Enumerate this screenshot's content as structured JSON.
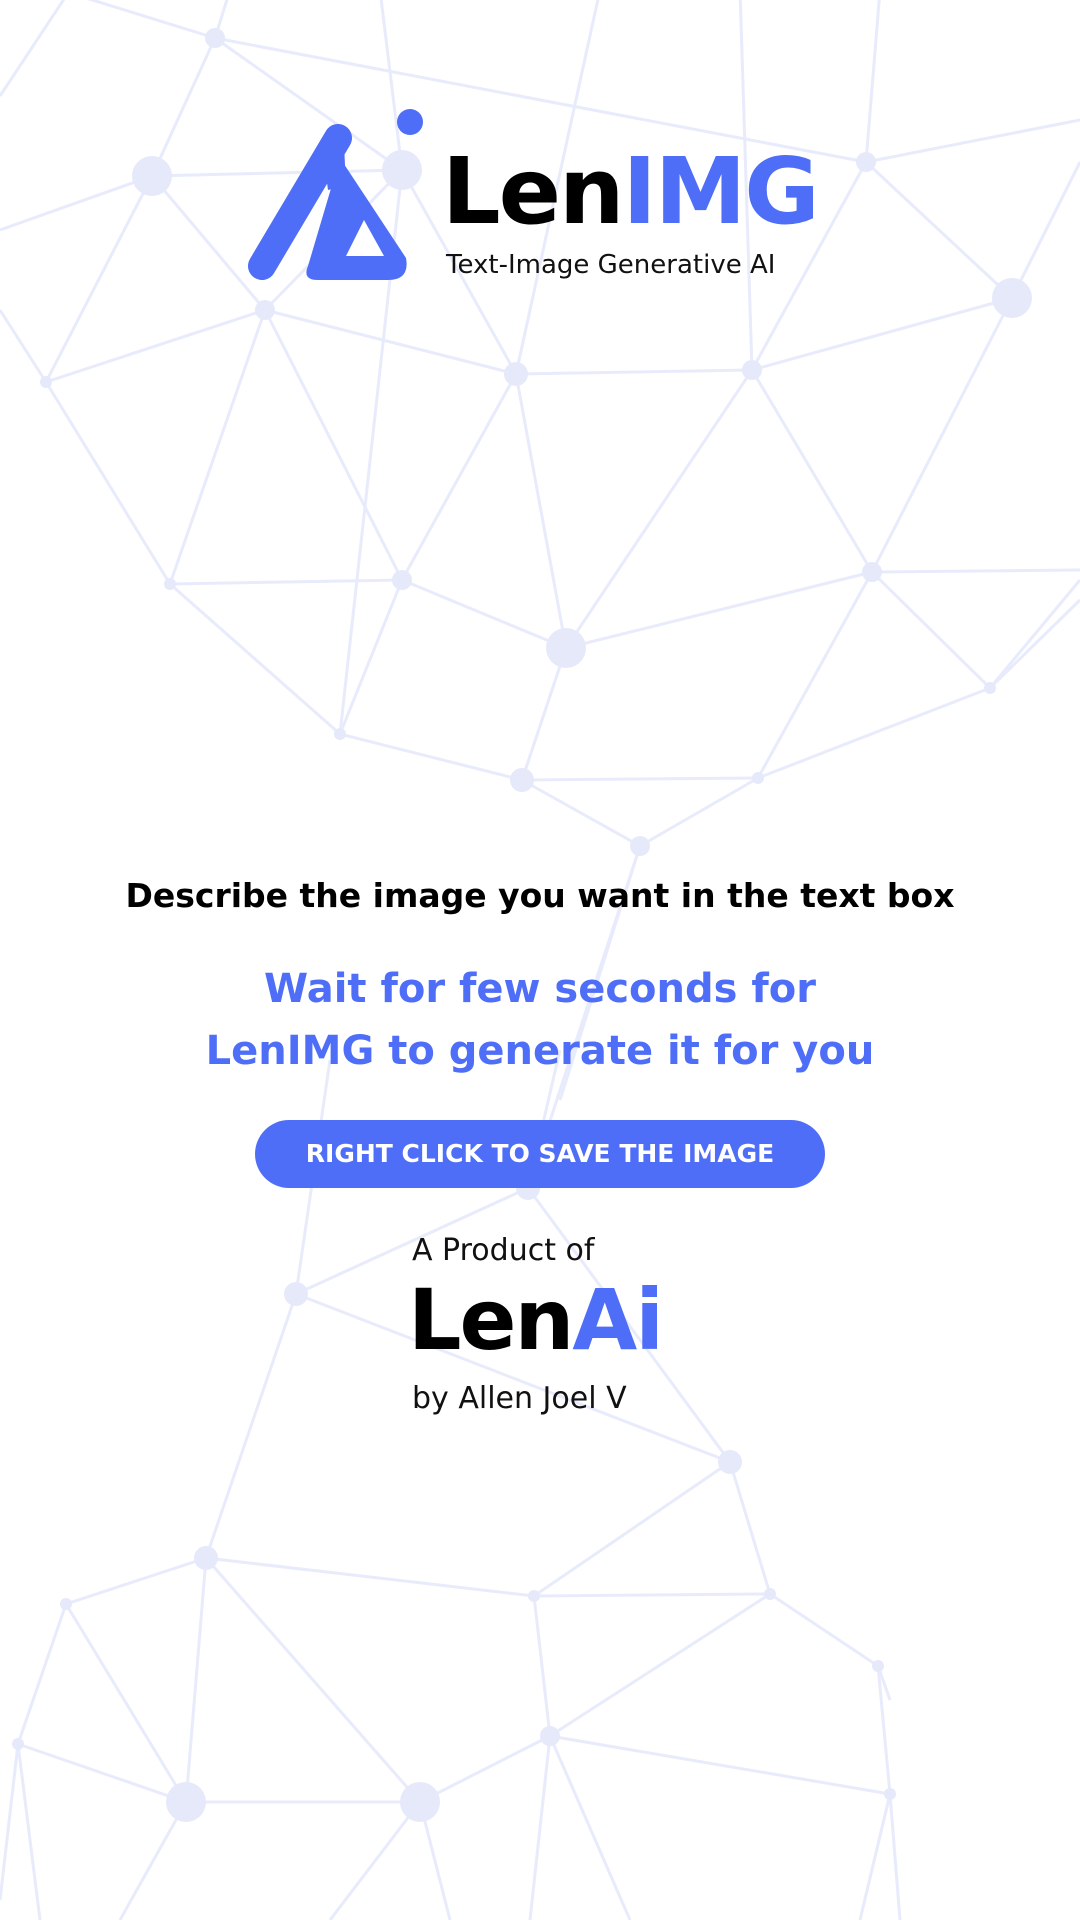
{
  "colors": {
    "accent": "#4f6ef7",
    "text": "#000000",
    "background": "#ffffff",
    "network_line": "#e8ebfb",
    "network_node": "#e6e9fa"
  },
  "logo": {
    "icon": "lenimg-logo-mark-icon",
    "name_part_1": "Len",
    "name_part_2": "IMG",
    "tagline": "Text-Image Generative AI"
  },
  "instructions": {
    "step_1": "Describe the image you want in the text box",
    "step_2_line_1": "Wait for few seconds for",
    "step_2_line_2": "LenIMG to generate it for you"
  },
  "save_button": {
    "label": "RIGHT CLICK TO SAVE THE IMAGE"
  },
  "footer": {
    "product_of": "A Product of",
    "brand_part_1": "Len",
    "brand_part_2": "Ai",
    "author": "by Allen Joel V"
  },
  "background": {
    "icon": "network-pattern-background"
  }
}
